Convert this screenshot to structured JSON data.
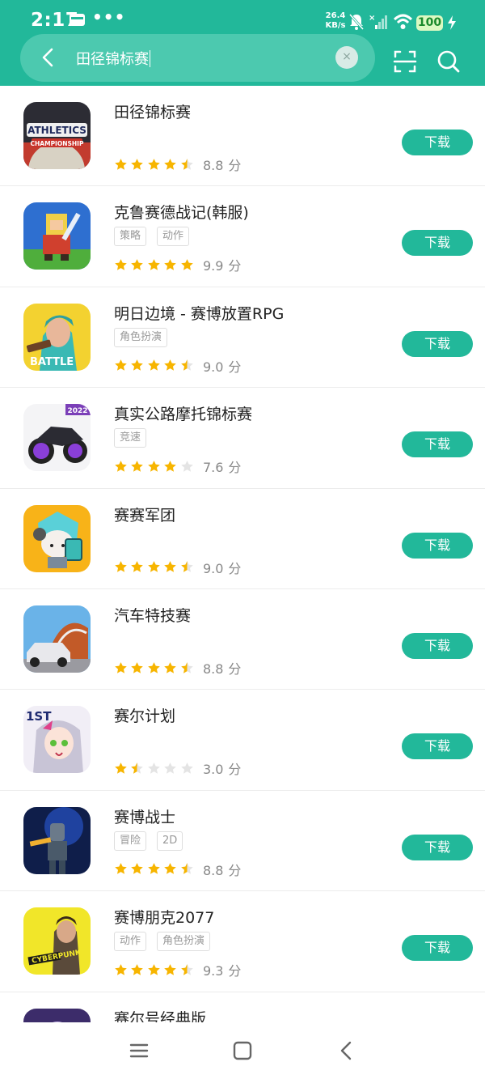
{
  "status_bar": {
    "time": "2:17",
    "dots": "•••",
    "net_speed_value": "26.4",
    "net_speed_unit": "KB/s",
    "battery": "100"
  },
  "search": {
    "query": "田径锦标赛",
    "clear_symbol": "×"
  },
  "download_label": "下载",
  "score_unit": "分",
  "apps": [
    {
      "name": "田径锦标赛",
      "tags": [],
      "rating": 4.5,
      "score": "8.8",
      "icon": "athletics-championship-icon"
    },
    {
      "name": "克鲁赛德战记(韩服)",
      "tags": [
        "策略",
        "动作"
      ],
      "rating": 5,
      "score": "9.9",
      "icon": "crusaders-knight-icon"
    },
    {
      "name": "明日边境 - 赛博放置RPG",
      "tags": [
        "角色扮演"
      ],
      "rating": 4.5,
      "score": "9.0",
      "icon": "cyber-heroine-icon"
    },
    {
      "name": "真实公路摩托锦标赛",
      "tags": [
        "竞速"
      ],
      "rating": 4,
      "score": "7.6",
      "icon": "motorcycle-icon"
    },
    {
      "name": "赛赛军团",
      "tags": [],
      "rating": 4.5,
      "score": "9.0",
      "icon": "chibi-knight-icon"
    },
    {
      "name": "汽车特技赛",
      "tags": [],
      "rating": 4.5,
      "score": "8.8",
      "icon": "stunt-car-icon"
    },
    {
      "name": "赛尔计划",
      "tags": [],
      "rating": 1.5,
      "score": "3.0",
      "icon": "anime-girl-icon"
    },
    {
      "name": "赛博战士",
      "tags": [
        "冒险",
        "2D"
      ],
      "rating": 4.5,
      "score": "8.8",
      "icon": "cyber-warrior-icon"
    },
    {
      "name": "赛博朋克2077",
      "tags": [
        "动作",
        "角色扮演"
      ],
      "rating": 4.5,
      "score": "9.3",
      "icon": "cyberpunk-icon"
    },
    {
      "name": "赛尔号经典版",
      "tags": [],
      "rating": 0,
      "score": "",
      "icon": "seer-classic-icon"
    }
  ]
}
